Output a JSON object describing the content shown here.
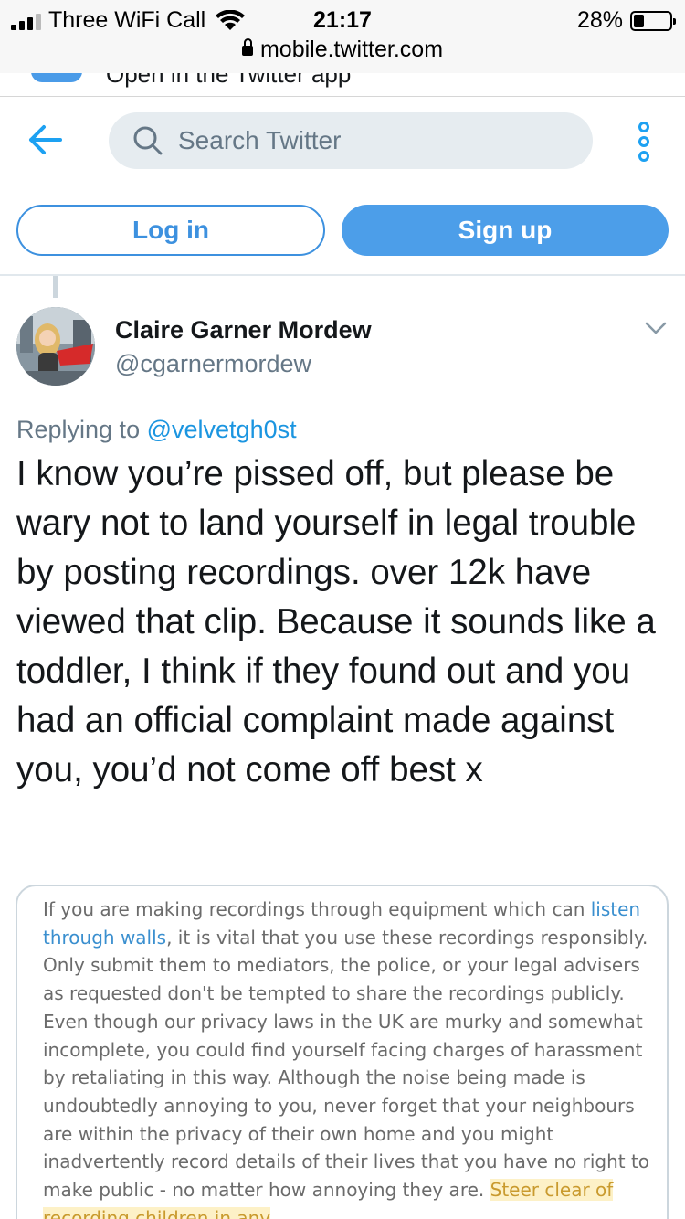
{
  "status_bar": {
    "carrier": "Three WiFi Call",
    "time": "21:17",
    "battery": "28%",
    "battery_level": 0.28
  },
  "browser": {
    "url": "mobile.twitter.com"
  },
  "app_banner": {
    "text": "Open in the Twitter app"
  },
  "header": {
    "search_placeholder": "Search Twitter",
    "login_label": "Log in",
    "signup_label": "Sign up"
  },
  "tweet": {
    "author_name": "Claire Garner Mordew",
    "author_handle": "@cgarnermordew",
    "replying_prefix": "Replying to",
    "replying_to": "@velvetgh0st",
    "text": "I know you’re pissed off, but please be wary not to land yourself in legal trouble by posting recordings. over 12k have viewed that clip. Because it sounds like a toddler, I think if they found out and you had an official complaint made against you, you’d not come off best x"
  },
  "attachment": {
    "intro": "If you are making recordings through equipment which can",
    "link_text": "listen through walls",
    "body": ", it is vital that you use these recordings responsibly. Only submit them to mediators, the police, or your legal advisers as requested  don't be tempted to share the recordings publicly. Even though our privacy laws in the UK are murky and somewhat incomplete, you could find yourself facing charges of harassment by retaliating in this way. Although the noise being made is undoubtedly annoying to you, never forget that your neighbours are within the privacy of their own home and you might inadvertently record details of their lives that you have no right to make public - no matter how annoying they are. ",
    "highlight": "Steer clear of recording children in any"
  }
}
